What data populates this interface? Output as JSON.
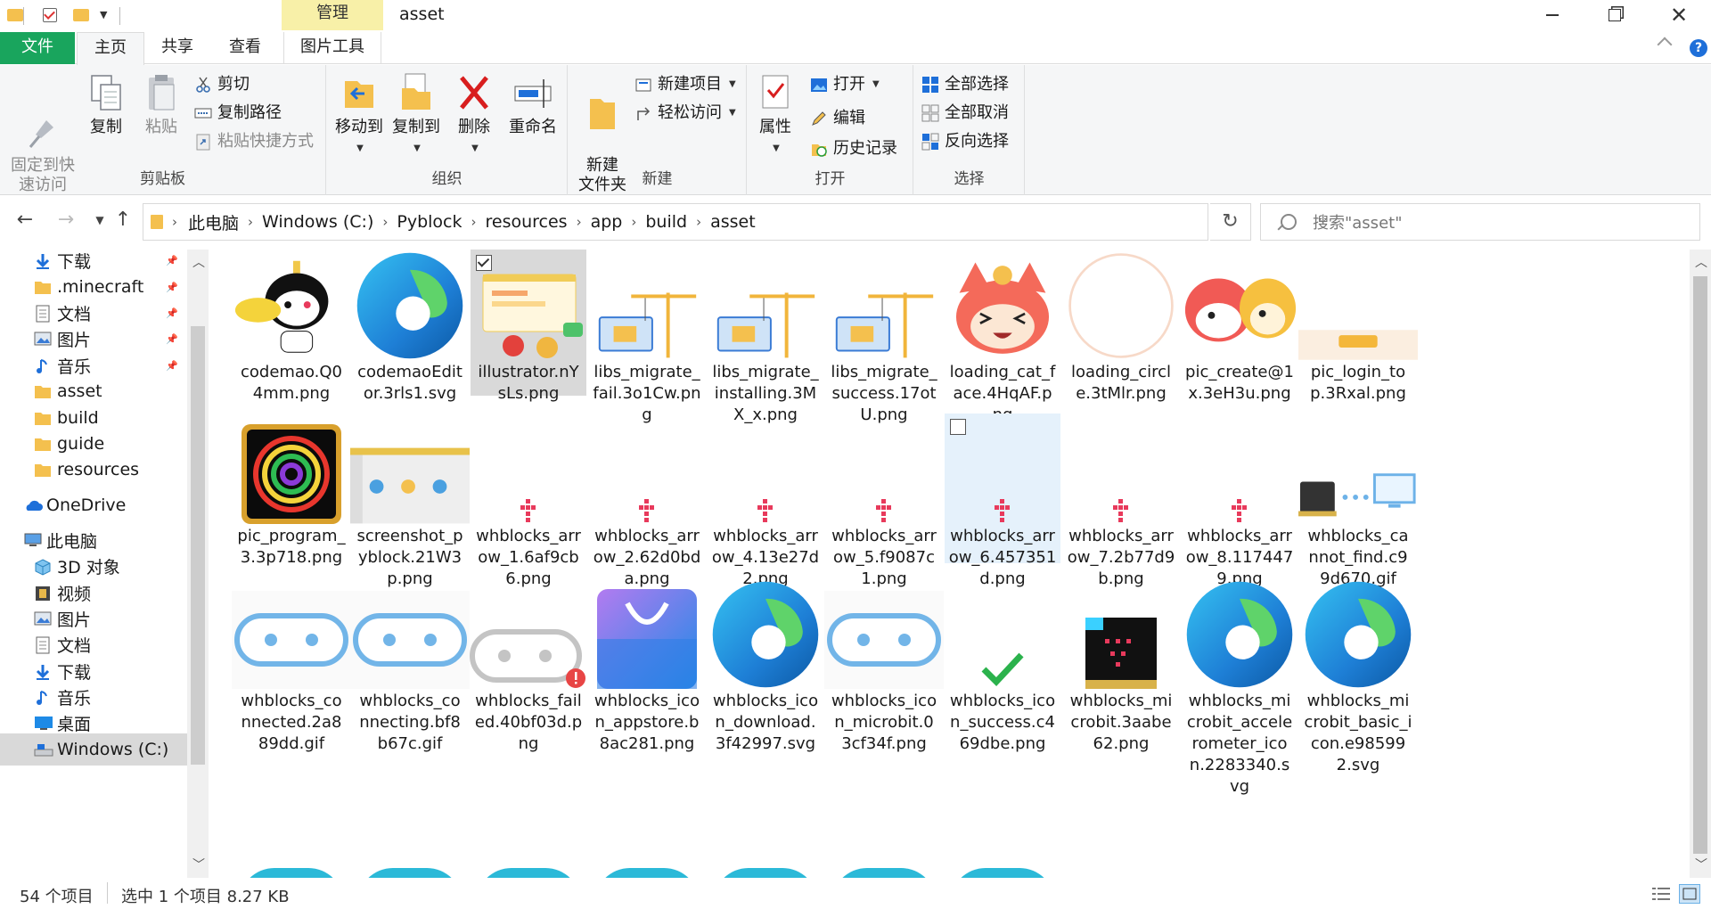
{
  "window": {
    "title": "asset",
    "manage_tab": "管理",
    "tabs": {
      "file": "文件",
      "home": "主页",
      "share": "共享",
      "view": "查看",
      "picture_tools": "图片工具"
    },
    "help": "?"
  },
  "ribbon": {
    "clipboard": {
      "label": "剪贴板",
      "pin": "固定到快\n速访问",
      "copy": "复制",
      "paste": "粘贴",
      "cut": "剪切",
      "copy_path": "复制路径",
      "paste_shortcut": "粘贴快捷方式"
    },
    "organize": {
      "label": "组织",
      "move_to": "移动到",
      "copy_to": "复制到",
      "delete": "删除",
      "rename": "重命名"
    },
    "new": {
      "label": "新建",
      "new_folder": "新建\n文件夹",
      "new_item": "新建项目",
      "easy_access": "轻松访问"
    },
    "open": {
      "label": "打开",
      "properties": "属性",
      "open": "打开",
      "edit": "编辑",
      "history": "历史记录"
    },
    "select": {
      "label": "选择",
      "select_all": "全部选择",
      "select_none": "全部取消",
      "invert": "反向选择"
    }
  },
  "address": {
    "crumbs": [
      "此电脑",
      "Windows (C:)",
      "Pyblock",
      "resources",
      "app",
      "build",
      "asset"
    ],
    "search_placeholder": "搜索\"asset\""
  },
  "nav": [
    {
      "label": "下载",
      "icon": "download-arrow-icon",
      "pinned": true
    },
    {
      "label": ".minecraft",
      "icon": "folder-icon",
      "pinned": true
    },
    {
      "label": "文档",
      "icon": "document-icon",
      "pinned": true
    },
    {
      "label": "图片",
      "icon": "picture-icon",
      "pinned": true
    },
    {
      "label": "音乐",
      "icon": "music-note-icon",
      "pinned": true
    },
    {
      "label": "asset",
      "icon": "folder-icon"
    },
    {
      "label": "build",
      "icon": "folder-icon"
    },
    {
      "label": "guide",
      "icon": "folder-icon"
    },
    {
      "label": "resources",
      "icon": "folder-icon"
    },
    {
      "label": "OneDrive",
      "icon": "cloud-icon"
    },
    {
      "label": "此电脑",
      "icon": "computer-icon"
    },
    {
      "label": "3D 对象",
      "icon": "cube-icon"
    },
    {
      "label": "视频",
      "icon": "film-icon"
    },
    {
      "label": "图片",
      "icon": "picture-icon"
    },
    {
      "label": "文档",
      "icon": "document-icon"
    },
    {
      "label": "下载",
      "icon": "download-arrow-icon"
    },
    {
      "label": "音乐",
      "icon": "music-note-icon"
    },
    {
      "label": "桌面",
      "icon": "desktop-icon"
    },
    {
      "label": "Windows (C:)",
      "icon": "drive-icon",
      "selected": true
    }
  ],
  "files": [
    {
      "name": "codemao.Q04mm.png",
      "thumb": "cat-mascot"
    },
    {
      "name": "codemaoEditor.3rls1.svg",
      "thumb": "edge-logo"
    },
    {
      "name": "illustrator.nYsLs.png",
      "thumb": "illustration",
      "selected": true,
      "checked": true
    },
    {
      "name": "libs_migrate_fail.3o1Cw.png",
      "thumb": "crane-fail"
    },
    {
      "name": "libs_migrate_installing.3MX_x.png",
      "thumb": "crane-install"
    },
    {
      "name": "libs_migrate_success.17otU.png",
      "thumb": "crane-success"
    },
    {
      "name": "loading_cat_face.4HqAF.png",
      "thumb": "cat-face"
    },
    {
      "name": "loading_circle.3tMlr.png",
      "thumb": "circle"
    },
    {
      "name": "pic_create@1x.3eH3u.png",
      "thumb": "cats"
    },
    {
      "name": "pic_login_top.3Rxal.png",
      "thumb": "banner"
    },
    {
      "name": "pic_program_3.3p718.png",
      "thumb": "spiral"
    },
    {
      "name": "screenshot_pyblock.21W3p.png",
      "thumb": "screenshot"
    },
    {
      "name": "whblocks_arrow_1.6af9cb6.png",
      "thumb": "arrow"
    },
    {
      "name": "whblocks_arrow_2.62d0bda.png",
      "thumb": "arrow"
    },
    {
      "name": "whblocks_arrow_4.13e27d2.png",
      "thumb": "arrow"
    },
    {
      "name": "whblocks_arrow_5.f9087c1.png",
      "thumb": "arrow"
    },
    {
      "name": "whblocks_arrow_6.457351d.png",
      "thumb": "arrow",
      "hover": true,
      "checked": false
    },
    {
      "name": "whblocks_arrow_7.2b77d9b.png",
      "thumb": "arrow"
    },
    {
      "name": "whblocks_arrow_8.1174479.png",
      "thumb": "arrow"
    },
    {
      "name": "whblocks_cannot_find.c99d670.gif",
      "thumb": "cannot-find"
    },
    {
      "name": "whblocks_connected.2a889dd.gif",
      "thumb": "pill-blue"
    },
    {
      "name": "whblocks_connecting.bf8b67c.gif",
      "thumb": "pill-blue"
    },
    {
      "name": "whblocks_failed.40bf03d.png",
      "thumb": "pill-grey"
    },
    {
      "name": "whblocks_icon_appstore.b8ac281.png",
      "thumb": "appstore"
    },
    {
      "name": "whblocks_icon_download.3f42997.svg",
      "thumb": "edge-logo"
    },
    {
      "name": "whblocks_icon_microbit.03cf34f.png",
      "thumb": "pill-blue"
    },
    {
      "name": "whblocks_icon_success.c469dbe.png",
      "thumb": "check"
    },
    {
      "name": "whblocks_microbit.3aabe62.png",
      "thumb": "microbit"
    },
    {
      "name": "whblocks_microbit_accelerometer_icon.2283340.svg",
      "thumb": "edge-logo"
    },
    {
      "name": "whblocks_microbit_basic_icon.e985992.svg",
      "thumb": "edge-logo"
    }
  ],
  "status": {
    "count": "54 个项目",
    "selected": "选中 1 个项目  8.27 KB"
  }
}
